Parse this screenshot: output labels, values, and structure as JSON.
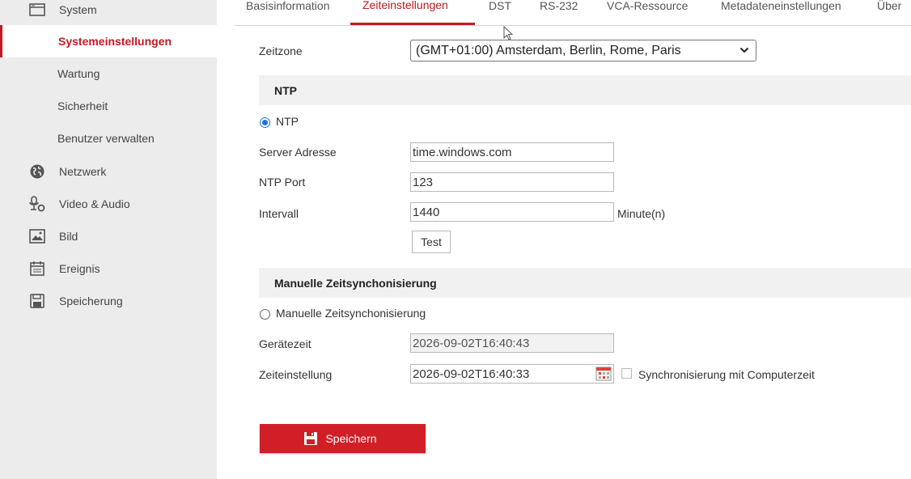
{
  "sidebar": {
    "items": [
      {
        "label": "System",
        "icon": "window-icon"
      },
      {
        "label": "Systemeinstellungen"
      },
      {
        "label": "Wartung"
      },
      {
        "label": "Sicherheit"
      },
      {
        "label": "Benutzer verwalten"
      },
      {
        "label": "Netzwerk",
        "icon": "globe-icon"
      },
      {
        "label": "Video & Audio",
        "icon": "microphone-icon"
      },
      {
        "label": "Bild",
        "icon": "image-icon"
      },
      {
        "label": "Ereignis",
        "icon": "calendar-icon"
      },
      {
        "label": "Speicherung",
        "icon": "save-icon"
      }
    ]
  },
  "tabs": [
    {
      "label": "Basisinformation"
    },
    {
      "label": "Zeiteinstellungen",
      "active": true
    },
    {
      "label": "DST"
    },
    {
      "label": "RS-232"
    },
    {
      "label": "VCA-Ressource"
    },
    {
      "label": "Metadateneinstellungen"
    },
    {
      "label": "Über"
    }
  ],
  "form": {
    "timezone_label": "Zeitzone",
    "timezone_value": "(GMT+01:00) Amsterdam, Berlin, Rome, Paris",
    "ntp_section": "NTP",
    "ntp_radio": "NTP",
    "server_label": "Server Adresse",
    "server_value": "time.windows.com",
    "port_label": "NTP Port",
    "port_value": "123",
    "interval_label": "Intervall",
    "interval_value": "1440",
    "interval_unit": "Minute(n)",
    "test_button": "Test",
    "manual_section": "Manuelle Zeitsynchonisierung",
    "manual_radio": "Manuelle Zeitsynchonisierung",
    "device_time_label": "Gerätezeit",
    "device_time_value": "2026-09-02T16:40:43",
    "time_setting_label": "Zeiteinstellung",
    "time_setting_value": "2026-09-02T16:40:33",
    "sync_computer_label": "Synchronisierung mit Computerzeit",
    "save_button": "Speichern"
  },
  "colors": {
    "accent": "#c21a22",
    "save_button": "#d21e26",
    "radio_selected": "#1a73e8",
    "sidebar_bg": "#ececec",
    "section_bg": "#f1f1f1"
  }
}
